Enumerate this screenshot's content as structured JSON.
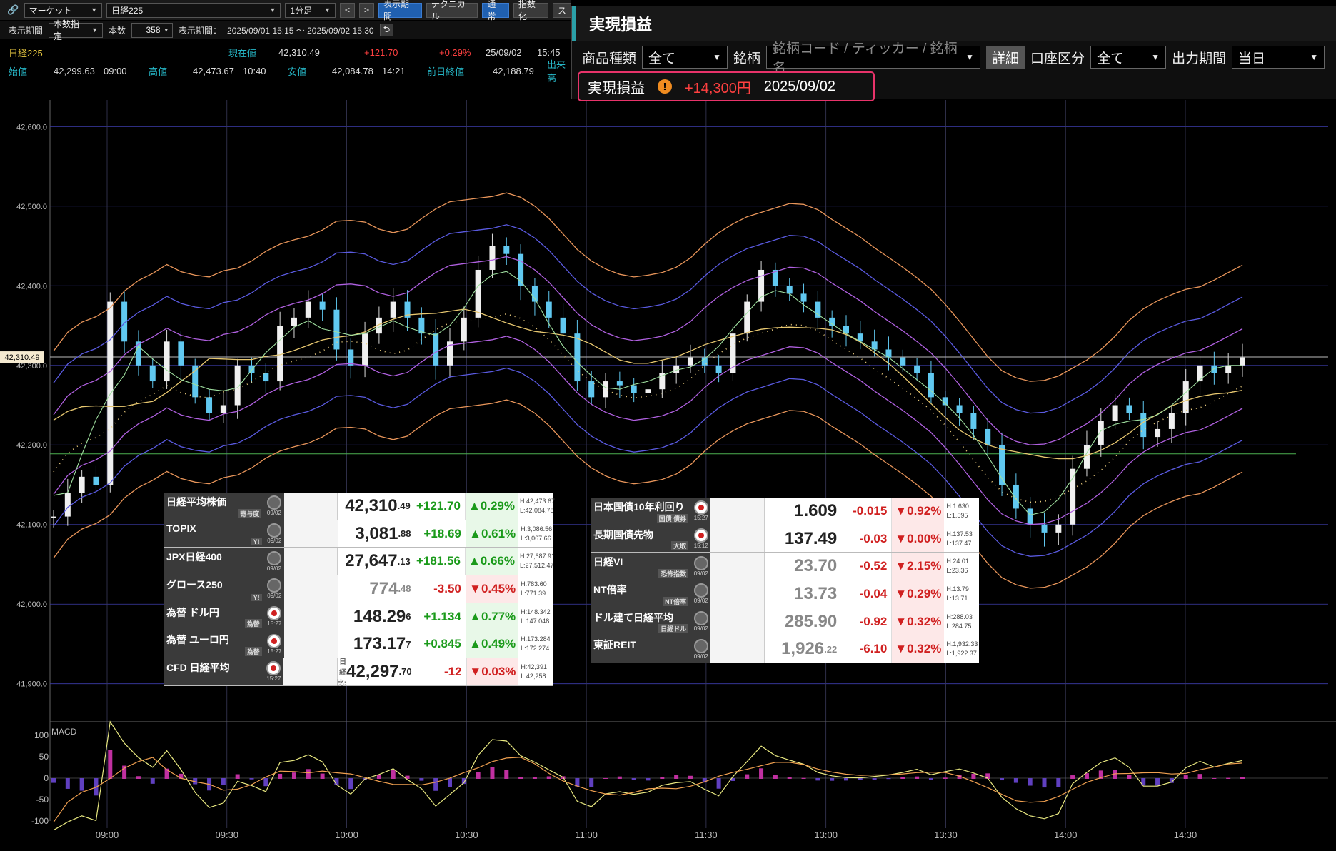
{
  "toolbar": {
    "market": "マーケット",
    "symbol": "日経225",
    "interval": "1分足",
    "prev_label": "<",
    "next_label": ">",
    "display_period_btn": "表示期間",
    "technical_btn": "テクニカル",
    "normal_btn": "通常",
    "index_btn": "指数化",
    "extra_btn": "ス"
  },
  "toolbar2": {
    "period_label": "表示期間",
    "period_mode": "本数指定",
    "count_label": "本数",
    "count_value": "358",
    "period_text": "表示期間：",
    "period_range": "2025/09/01 15:15 ～ 2025/09/02 15:30"
  },
  "quote": {
    "name": "日経225",
    "current_label": "現在値",
    "current": "42,310.49",
    "change": "+121.70",
    "change_pct": "+0.29%",
    "date": "25/09/02",
    "time": "15:45",
    "volume_label": "出来高",
    "open_label": "始値",
    "open": "42,299.63",
    "open_time": "09:00",
    "high_label": "高値",
    "high": "42,473.67",
    "high_time": "10:40",
    "low_label": "安値",
    "low": "42,084.78",
    "low_time": "14:21",
    "prev_close_label": "前日終値",
    "prev_close": "42,188.79"
  },
  "pnl": {
    "title": "実現損益",
    "product_label": "商品種類",
    "product_value": "全て",
    "symbol_label": "銘柄",
    "symbol_placeholder": "銘柄コード / ティッカー / 銘柄名",
    "detail_btn": "詳細",
    "account_label": "口座区分",
    "account_value": "全て",
    "output_label": "出力期間",
    "output_value": "当日",
    "result_label": "実現損益",
    "result_amount": "+14,300円",
    "result_date": "2025/09/02"
  },
  "chart_data": {
    "type": "candlestick",
    "y_axis_labels": [
      "42,600.0",
      "42,500.0",
      "42,400.0",
      "42,300.0",
      "42,200.0",
      "42,100.0",
      "42,000.0",
      "41,900.0"
    ],
    "x_axis_labels": [
      "09:00",
      "09:30",
      "10:00",
      "10:30",
      "11:00",
      "11:30",
      "13:00",
      "13:30",
      "14:00",
      "14:30"
    ],
    "current_price_label": "42,310.49",
    "prev_close": 42188.79,
    "ylim": [
      41880,
      42620
    ],
    "macd_label": "MACD",
    "macd_ticks": [
      "100",
      "50",
      "0",
      "-50",
      "-100"
    ],
    "close_series": [
      42110,
      42140,
      42160,
      42150,
      42380,
      42330,
      42300,
      42280,
      42330,
      42300,
      42260,
      42240,
      42250,
      42300,
      42290,
      42280,
      42350,
      42360,
      42380,
      42370,
      42320,
      42300,
      42340,
      42360,
      42380,
      42360,
      42340,
      42300,
      42330,
      42360,
      42420,
      42450,
      42440,
      42400,
      42380,
      42360,
      42340,
      42280,
      42260,
      42280,
      42275,
      42265,
      42270,
      42290,
      42300,
      42310,
      42300,
      42290,
      42340,
      42380,
      42420,
      42400,
      42390,
      42380,
      42360,
      42350,
      42340,
      42330,
      42320,
      42310,
      42300,
      42290,
      42260,
      42250,
      42240,
      42220,
      42200,
      42150,
      42120,
      42100,
      42090,
      42100,
      42170,
      42200,
      42230,
      42250,
      42240,
      42210,
      42220,
      42240,
      42280,
      42300,
      42290,
      42300,
      42310
    ]
  },
  "mkt_left": [
    {
      "name": "日経平均株価",
      "sub": "寄与度",
      "date": "09/02",
      "price_main": "42,310",
      "price_dec": ".49",
      "chg": "+121.70",
      "pct": "▲0.29%",
      "dir": "up",
      "h": "H:42,473.67",
      "l": "L:42,084.78"
    },
    {
      "name": "TOPIX",
      "sub": "Y!",
      "date": "09/02",
      "price_main": "3,081",
      "price_dec": ".88",
      "chg": "+18.69",
      "pct": "▲0.61%",
      "dir": "up",
      "h": "H:3,086.56",
      "l": "L:3,067.66"
    },
    {
      "name": "JPX日経400",
      "sub": "",
      "date": "09/02",
      "price_main": "27,647",
      "price_dec": ".13",
      "chg": "+181.56",
      "pct": "▲0.66%",
      "dir": "up",
      "h": "H:27,687.91",
      "l": "L:27,512.47"
    },
    {
      "name": "グロース250",
      "sub": "Y!",
      "date": "09/02",
      "price_main": "774",
      "price_dec": ".48",
      "chg": "-3.50",
      "pct": "▼0.45%",
      "dir": "dn",
      "h": "H:783.60",
      "l": "L:771.39"
    },
    {
      "name": "為替 ドル円",
      "sub": "為替",
      "date": "15:27",
      "price_main": "148.29",
      "price_dec": "6",
      "chg": "+1.134",
      "pct": "▲0.77%",
      "dir": "up",
      "h": "H:148.342",
      "l": "L:147.048"
    },
    {
      "name": "為替 ユーロ円",
      "sub": "為替",
      "date": "15:27",
      "price_main": "173.17",
      "price_dec": "7",
      "chg": "+0.845",
      "pct": "▲0.49%",
      "dir": "up",
      "h": "H:173.284",
      "l": "L:172.274"
    },
    {
      "name": "CFD 日経平均",
      "sub": "",
      "date": "15:27",
      "price_main": "42,297",
      "price_dec": ".70",
      "chg": "-12",
      "pct": "▼0.03%",
      "dir": "dn",
      "h": "H:42,391",
      "l": "L:42,258",
      "extra": "日経比:"
    }
  ],
  "mkt_right": [
    {
      "name": "日本国債10年利回り",
      "sub": "国債 債券",
      "date": "15:27",
      "price": "1.609",
      "chg": "-0.015",
      "pct": "▼0.92%",
      "dir": "dn",
      "h": "H:1.630",
      "l": "L:1.595"
    },
    {
      "name": "長期国債先物",
      "sub": "大取",
      "date": "15:12",
      "price": "137.49",
      "chg": "-0.03",
      "pct": "▼0.00%",
      "dir": "dn",
      "h": "H:137.53",
      "l": "L:137.47"
    },
    {
      "name": "日経VI",
      "sub": "恐怖指数",
      "date": "09/02",
      "price": "23.70",
      "chg": "-0.52",
      "pct": "▼2.15%",
      "dir": "dn",
      "h": "H:24.01",
      "l": "L:23.36"
    },
    {
      "name": "NT倍率",
      "sub": "NT倍率",
      "date": "09/02",
      "price": "13.73",
      "chg": "-0.04",
      "pct": "▼0.29%",
      "dir": "dn",
      "h": "H:13.79",
      "l": "L:13.71"
    },
    {
      "name": "ドル建て日経平均",
      "sub": "日経ドル",
      "date": "09/02",
      "price": "285.90",
      "chg": "-0.92",
      "pct": "▼0.32%",
      "dir": "dn",
      "h": "H:288.03",
      "l": "L:284.75"
    },
    {
      "name": "東証REIT",
      "sub": "",
      "date": "09/02",
      "price_main": "1,926",
      "price_dec": ".22",
      "chg": "-6.10",
      "pct": "▼0.32%",
      "dir": "dn",
      "h": "H:1,932.33",
      "l": "L:1,922.37"
    }
  ]
}
